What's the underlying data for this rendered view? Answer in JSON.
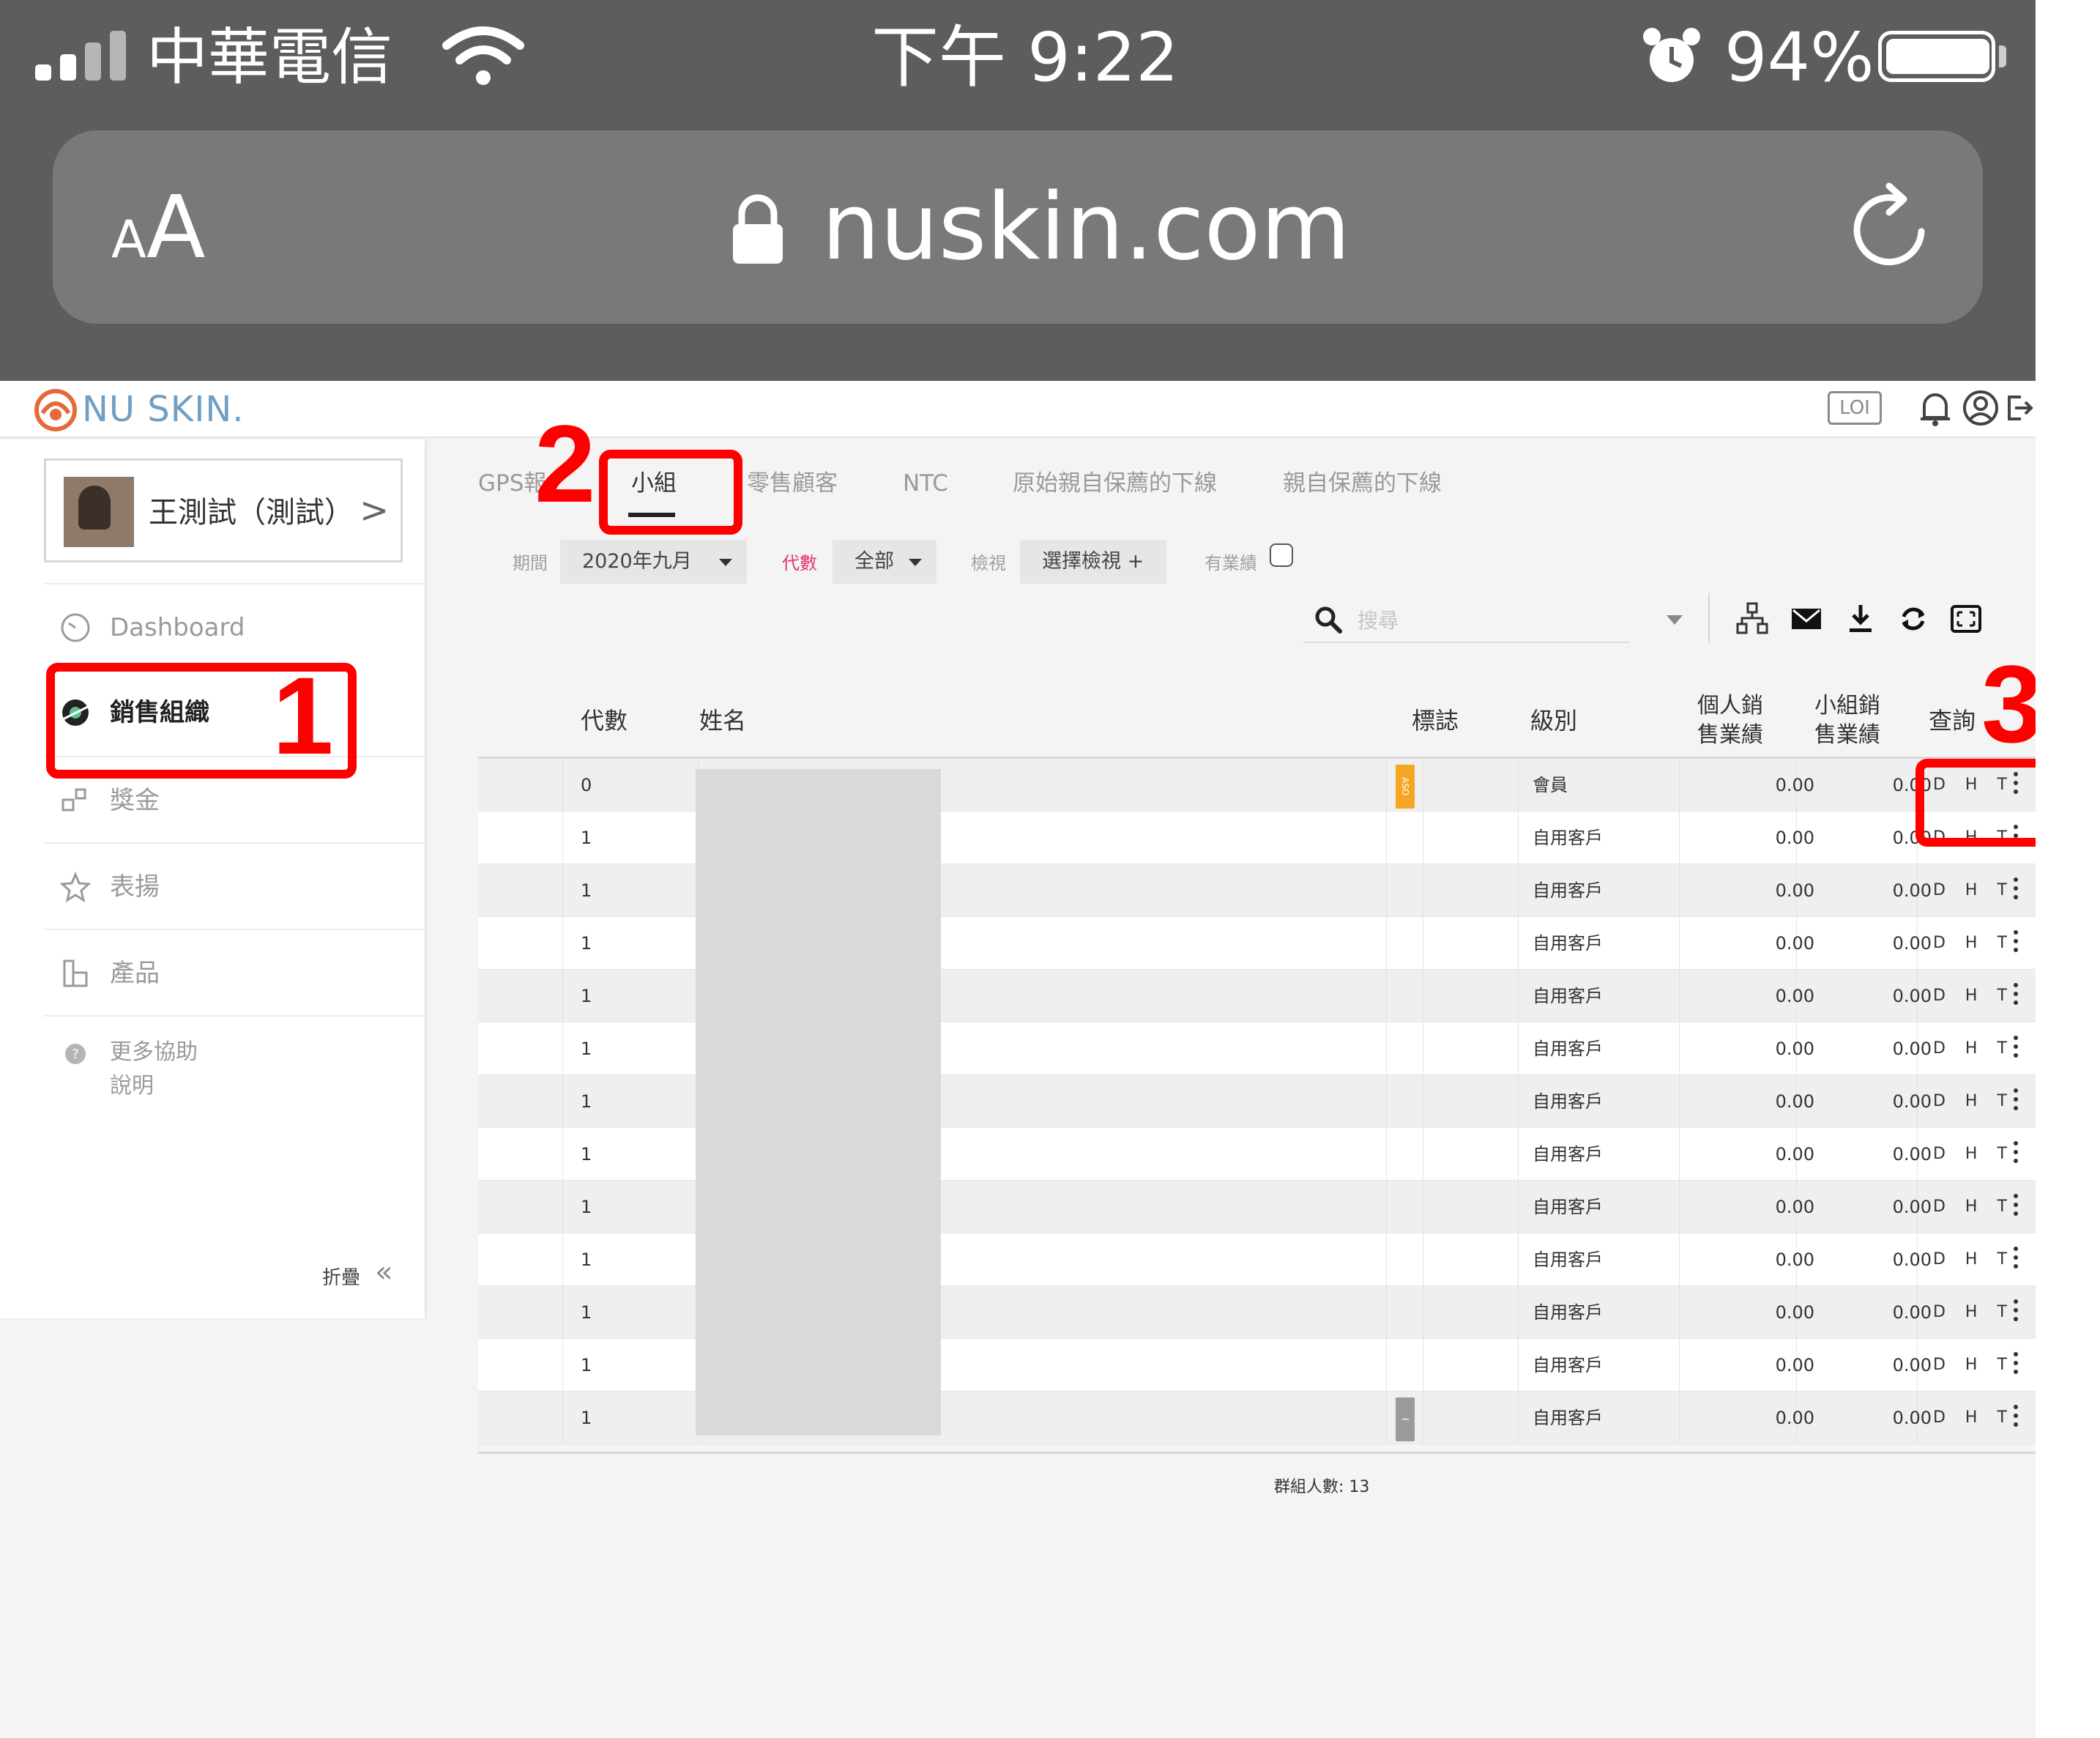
{
  "status_bar": {
    "carrier": "中華電信",
    "time": "下午 9:22",
    "battery": "94%",
    "battery_level": 0.94
  },
  "browser": {
    "text_size_small": "A",
    "text_size_big": "A",
    "url": "nuskin.com"
  },
  "site_header": {
    "brand": "NU SKIN.",
    "lo_badge": "LOI"
  },
  "sidebar": {
    "user_name": "王測試（測試）",
    "items": [
      {
        "label": "Dashboard",
        "icon": "gauge-icon"
      },
      {
        "label": "銷售組織",
        "icon": "organization-icon"
      },
      {
        "label": "獎金",
        "icon": "bonus-icon"
      },
      {
        "label": "表揚",
        "icon": "star-icon"
      },
      {
        "label": "產品",
        "icon": "product-icon"
      },
      {
        "label": "更多協助",
        "label2": "說明",
        "icon": "help-icon"
      }
    ],
    "collapse_label": "折疊",
    "collapse_arrows": "«"
  },
  "tabs": [
    "GPS報",
    "小組",
    "零售顧客",
    "NTC",
    "原始親自保薦的下線",
    "親自保薦的下線"
  ],
  "active_tab": "小組",
  "filters": {
    "period_label": "期間",
    "period_value": "2020年九月",
    "generation_label": "代數",
    "generation_value": "全部",
    "view_label": "檢視",
    "view_value": "選擇檢視 +",
    "has_sales_label": "有業績"
  },
  "search": {
    "placeholder": "搜尋"
  },
  "table": {
    "headers": {
      "generation": "代數",
      "name": "姓名",
      "flag": "標誌",
      "level": "級別",
      "personal_sales_1": "個人銷",
      "personal_sales_2": "售業績",
      "group_sales_1": "小組銷",
      "group_sales_2": "售業績",
      "query": "查詢"
    },
    "rows": [
      {
        "gen": "0",
        "level": "會員",
        "pv": "0.00",
        "gv": "0.00",
        "actions": "D H T",
        "flag": "ASO"
      },
      {
        "gen": "1",
        "level": "自用客戶",
        "pv": "0.00",
        "gv": "0.00",
        "actions": "D H T"
      },
      {
        "gen": "1",
        "level": "自用客戶",
        "pv": "0.00",
        "gv": "0.00",
        "actions": "D H T"
      },
      {
        "gen": "1",
        "level": "自用客戶",
        "pv": "0.00",
        "gv": "0.00",
        "actions": "D H T"
      },
      {
        "gen": "1",
        "level": "自用客戶",
        "pv": "0.00",
        "gv": "0.00",
        "actions": "D H T"
      },
      {
        "gen": "1",
        "level": "自用客戶",
        "pv": "0.00",
        "gv": "0.00",
        "actions": "D H T"
      },
      {
        "gen": "1",
        "level": "自用客戶",
        "pv": "0.00",
        "gv": "0.00",
        "actions": "D H T"
      },
      {
        "gen": "1",
        "level": "自用客戶",
        "pv": "0.00",
        "gv": "0.00",
        "actions": "D H T"
      },
      {
        "gen": "1",
        "level": "自用客戶",
        "pv": "0.00",
        "gv": "0.00",
        "actions": "D H T"
      },
      {
        "gen": "1",
        "level": "自用客戶",
        "pv": "0.00",
        "gv": "0.00",
        "actions": "D H T"
      },
      {
        "gen": "1",
        "level": "自用客戶",
        "pv": "0.00",
        "gv": "0.00",
        "actions": "D H T"
      },
      {
        "gen": "1",
        "level": "自用客戶",
        "pv": "0.00",
        "gv": "0.00",
        "actions": "D H T"
      },
      {
        "gen": "1",
        "level": "自用客戶",
        "pv": "0.00",
        "gv": "0.00",
        "actions": "D H T",
        "flag": "I"
      }
    ],
    "group_count": "群組人數: 13"
  },
  "annotations": {
    "one": "1",
    "two": "2",
    "three": "3"
  },
  "colors": {
    "annotation": "#ff0000",
    "chrome": "#5d5d5d",
    "flag_aso": "#f5a623",
    "flag_grey": "#9b9b9b",
    "generation_label": "#e5336b"
  }
}
